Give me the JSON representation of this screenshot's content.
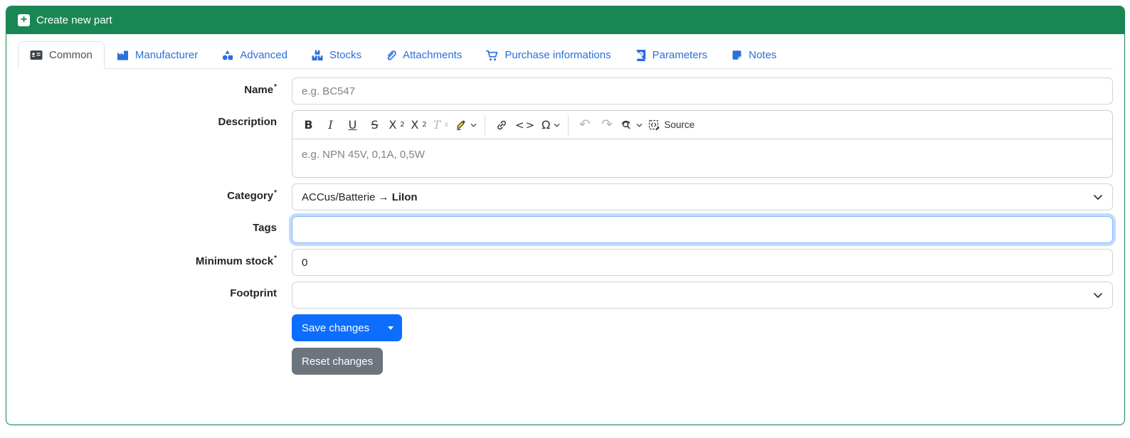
{
  "header": {
    "title": "Create new part"
  },
  "icons": {
    "plus": "+"
  },
  "colors": {
    "header_green": "#198754",
    "tab_blue": "#2b6fdb",
    "active_tab_text": "#495057",
    "save_blue": "#0d6efd",
    "reset_gray": "#6c757d",
    "focus_ring": "rgba(13,110,253,.25)",
    "input_border": "#ced4da",
    "highlighter_yellow": "#f5d90f"
  },
  "tabs": [
    {
      "label": "Common",
      "icon": "id-card-icon",
      "active": true
    },
    {
      "label": "Manufacturer",
      "icon": "factory-icon",
      "active": false
    },
    {
      "label": "Advanced",
      "icon": "shapes-icon",
      "active": false
    },
    {
      "label": "Stocks",
      "icon": "boxes-icon",
      "active": false
    },
    {
      "label": "Attachments",
      "icon": "paperclip-icon",
      "active": false
    },
    {
      "label": "Purchase informations",
      "icon": "cart-icon",
      "active": false
    },
    {
      "label": "Parameters",
      "icon": "atlas-book-icon",
      "active": false
    },
    {
      "label": "Notes",
      "icon": "sticky-note-icon",
      "active": false
    }
  ],
  "form": {
    "name": {
      "label": "Name",
      "required_mark": "*",
      "placeholder": "e.g. BC547",
      "value": ""
    },
    "description": {
      "label": "Description"
    },
    "category": {
      "label": "Category",
      "required_mark": "*",
      "value_prefix": "ACCus/Batterie",
      "value_arrow": "→",
      "value_leaf": "LiIon"
    },
    "tags": {
      "label": "Tags",
      "value": "",
      "focused": true
    },
    "minimum_stock": {
      "label": "Minimum stock",
      "required_mark": "*",
      "value": "0"
    },
    "footprint": {
      "label": "Footprint",
      "value": ""
    }
  },
  "editor": {
    "placeholder": "e.g. NPN 45V, 0,1A, 0,5W",
    "toolbar": {
      "bold": "B",
      "italic": "I",
      "underline": "U",
      "strikethrough": "S",
      "subscript_base": "X",
      "subscript_sub": "2",
      "superscript_base": "X",
      "superscript_sup": "2",
      "remove_format_base": "T",
      "remove_format_sub": "x",
      "special_char": "Ω",
      "code": "<>",
      "undo": "↶",
      "redo": "↷",
      "source_label": "Source"
    }
  },
  "buttons": {
    "save": "Save changes",
    "reset": "Reset changes"
  }
}
